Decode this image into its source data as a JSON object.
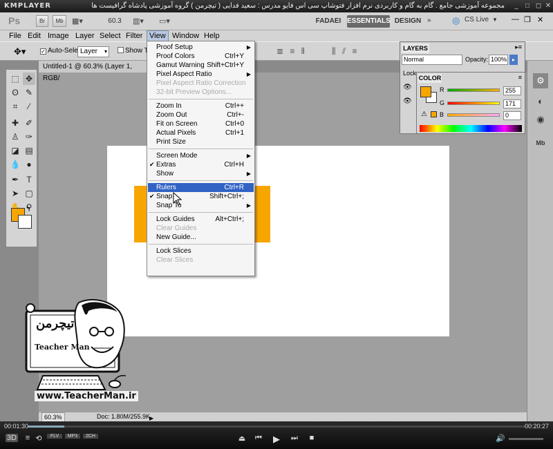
{
  "player": {
    "logo": "KMPLAYER",
    "caption": "مجموعه آموزشی جامع . گام به گام و کاربردی نرم افزار فتوشاپ سی اس فایو  مدرس : سعید فدایی ( تیچرمن ) گروه آموزشی پادشاه گرافیست ها",
    "time_elapsed": "00:01:30",
    "time_total": "00:20:27",
    "progress": 0.073,
    "controls": [
      "3D",
      "≡",
      "⟲",
      "FLV",
      "MP3",
      "2CH",
      "⏏",
      "⏮",
      "▶",
      "⏭",
      "■",
      "🔊"
    ]
  },
  "appbar": {
    "logo": "Ps",
    "btn_br": "Br",
    "btn_mb": "Mb",
    "zoom": "60.3",
    "workspaces": [
      "FADAEI",
      "ESSENTIALS",
      "DESIGN"
    ],
    "cs_live": "CS Live"
  },
  "menubar": [
    "File",
    "Edit",
    "Image",
    "Layer",
    "Select",
    "Filter",
    "View",
    "Window",
    "Help"
  ],
  "options": {
    "auto_select_label": "Auto-Select:",
    "auto_select_value": "Layer",
    "show_transform": "Show Tr"
  },
  "document": {
    "tab": "Untitled-1 @ 60.3% (Layer 1, RGB/",
    "zoom_status": "60.3%",
    "doc_status": "Doc: 1.80M/255.9K"
  },
  "layers": {
    "tab": "LAYERS",
    "blend_mode": "Normal",
    "opacity_label": "Opacity:",
    "opacity_value": "100%",
    "lock_label": "Lock"
  },
  "color_panel": {
    "tab": "COLOR",
    "r_label": "R",
    "g_label": "G",
    "b_label": "B",
    "r": "255",
    "g": "171",
    "b": "0",
    "fg_color": "#F7A600"
  },
  "view_menu": {
    "items": [
      {
        "label": "Proof Setup",
        "shortcut": "",
        "submenu": true
      },
      {
        "label": "Proof Colors",
        "shortcut": "Ctrl+Y"
      },
      {
        "label": "Gamut Warning",
        "shortcut": "Shift+Ctrl+Y"
      },
      {
        "label": "Pixel Aspect Ratio",
        "shortcut": "",
        "submenu": true
      },
      {
        "label": "Pixel Aspect Ratio Correction",
        "shortcut": "",
        "disabled": true
      },
      {
        "label": "32-bit Preview Options...",
        "shortcut": "",
        "disabled": true
      },
      {
        "label": "Zoom In",
        "shortcut": "Ctrl++"
      },
      {
        "label": "Zoom Out",
        "shortcut": "Ctrl+-"
      },
      {
        "label": "Fit on Screen",
        "shortcut": "Ctrl+0"
      },
      {
        "label": "Actual Pixels",
        "shortcut": "Ctrl+1"
      },
      {
        "label": "Print Size",
        "shortcut": ""
      },
      {
        "label": "Screen Mode",
        "shortcut": "",
        "submenu": true
      },
      {
        "label": "Extras",
        "shortcut": "Ctrl+H",
        "checked": true
      },
      {
        "label": "Show",
        "shortcut": "",
        "submenu": true
      },
      {
        "label": "Rulers",
        "shortcut": "Ctrl+R",
        "highlight": true
      },
      {
        "label": "Snap",
        "shortcut": "Shift+Ctrl+;",
        "checked": true
      },
      {
        "label": "Snap To",
        "shortcut": "",
        "submenu": true
      },
      {
        "label": "Lock Guides",
        "shortcut": "Alt+Ctrl+;"
      },
      {
        "label": "Clear Guides",
        "shortcut": "",
        "disabled": true
      },
      {
        "label": "New Guide...",
        "shortcut": ""
      },
      {
        "label": "Lock Slices",
        "shortcut": ""
      },
      {
        "label": "Clear Slices",
        "shortcut": "",
        "disabled": true
      }
    ]
  },
  "watermark": {
    "brand_fa": "تیچرمن",
    "brand_en": "Teacher Man",
    "url": "www.TeacherMan.ir"
  },
  "colors": {
    "accent_orange": "#F7A600",
    "menu_highlight": "#3163c5"
  }
}
